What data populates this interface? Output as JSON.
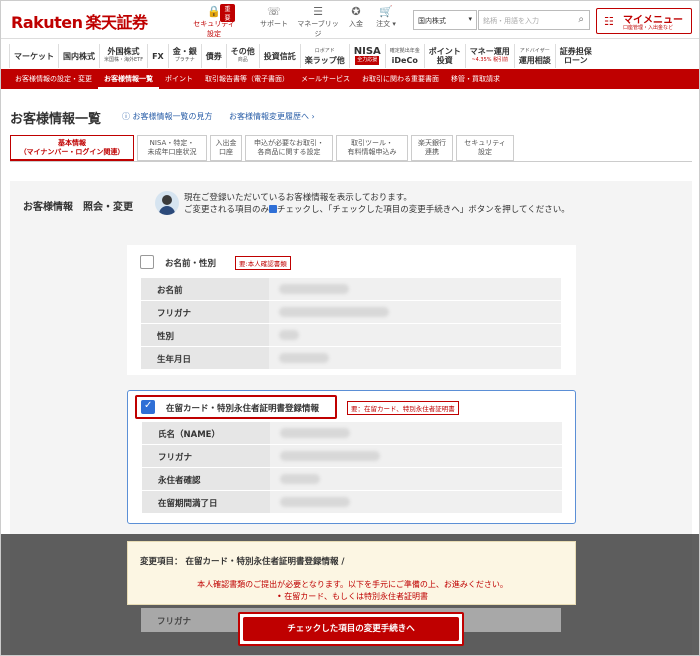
{
  "brand": {
    "logo_en": "Rakuten",
    "logo_jp": "楽天証券"
  },
  "header": {
    "icons": [
      {
        "label": "セキュリティ設定",
        "icon": "lock-icon",
        "badge": "重要"
      },
      {
        "label": "サポート",
        "icon": "support-icon"
      },
      {
        "label": "マネーブリッジ",
        "icon": "bridge-icon"
      },
      {
        "label": "入金",
        "icon": "deposit-icon"
      },
      {
        "label": "注文 ▾",
        "icon": "cart-icon"
      }
    ],
    "select_value": "国内株式",
    "search_placeholder": "銘柄・用語を入力",
    "mymenu_title": "マイメニュー",
    "mymenu_sub": "口座管理・入出金など"
  },
  "nav": [
    {
      "l1": "マーケット"
    },
    {
      "l1": "国内株式"
    },
    {
      "l1": "外国株式",
      "l2": "米国株・海外ETF"
    },
    {
      "l1": "FX"
    },
    {
      "l1": "金・銀",
      "l2": "プラチナ"
    },
    {
      "l1": "債券"
    },
    {
      "l1": "その他",
      "l2": "商品"
    },
    {
      "l1": "投資信託"
    },
    {
      "l1": "ロボアド",
      "l2": "楽ラップ他"
    },
    {
      "l1": "NISA",
      "l2": "全力応援"
    },
    {
      "l1": "確定拠出年金",
      "l2": "iDeCo"
    },
    {
      "l1": "ポイント",
      "l2": "投資"
    },
    {
      "l1": "マネー運用",
      "l2": "~4.35% 税引前"
    },
    {
      "l1": "アドバイザー",
      "l2": "運用相談"
    },
    {
      "l1": "証券担保",
      "l2": "ローン"
    }
  ],
  "subnav": [
    "お客様情報の設定・変更",
    "お客様情報一覧",
    "ポイント",
    "取引報告書等（電子書面）",
    "メールサービス",
    "お取引に関わる重要書面",
    "移管・買取請求"
  ],
  "page": {
    "title": "お客様情報一覧",
    "link1": "お客様情報一覧の見方",
    "link2": "お客様情報変更履歴へ ›"
  },
  "tabs": [
    {
      "l1": "基本情報",
      "l2": "（マイナンバー・ログイン関連）"
    },
    {
      "l1": "NISA・特定・",
      "l2": "未成年口座状況"
    },
    {
      "l1": "入出金",
      "l2": "口座"
    },
    {
      "l1": "申込が必要なお取引・",
      "l2": "各商品に関する設定"
    },
    {
      "l1": "取引ツール・",
      "l2": "有料情報申込み"
    },
    {
      "l1": "楽天銀行",
      "l2": "連携"
    },
    {
      "l1": "セキュリティ",
      "l2": "設定"
    }
  ],
  "info": {
    "heading": "お客様情報　照会・変更",
    "msg1": "現在ご登録いただいているお客様情報を表示しております。",
    "msg2a": "ご変更される項目のみ",
    "msg2b": "チェックし、「チェックした項目の変更手続きへ」ボタンを押してください。"
  },
  "card1": {
    "title": "お名前・性別",
    "tag": "要:本人確認書類",
    "checked": false,
    "rows": [
      "お名前",
      "フリガナ",
      "性別",
      "生年月日"
    ]
  },
  "card2": {
    "title": "在留カード・特別永住者証明書登録情報",
    "tag": "要：在留カード、特別永住者証明書",
    "checked": true,
    "rows": [
      "氏名（NAME）",
      "フリガナ",
      "永住者確認",
      "在留期間満了日"
    ]
  },
  "panel": {
    "heading": "変更項目：  在留カード・特別永住者証明書登録情報 /",
    "note1": "本人確認書類のご提出が必要となります。以下を手元にご準備の上、お進みください。",
    "note2": "• 在留カード、もしくは特別永住者証明書"
  },
  "under_row": "フリガナ",
  "cta": "チェックした項目の変更手続きへ",
  "colors": {
    "brand": "#bf0000",
    "check": "#2f6fd6",
    "link": "#2b5fa8"
  }
}
